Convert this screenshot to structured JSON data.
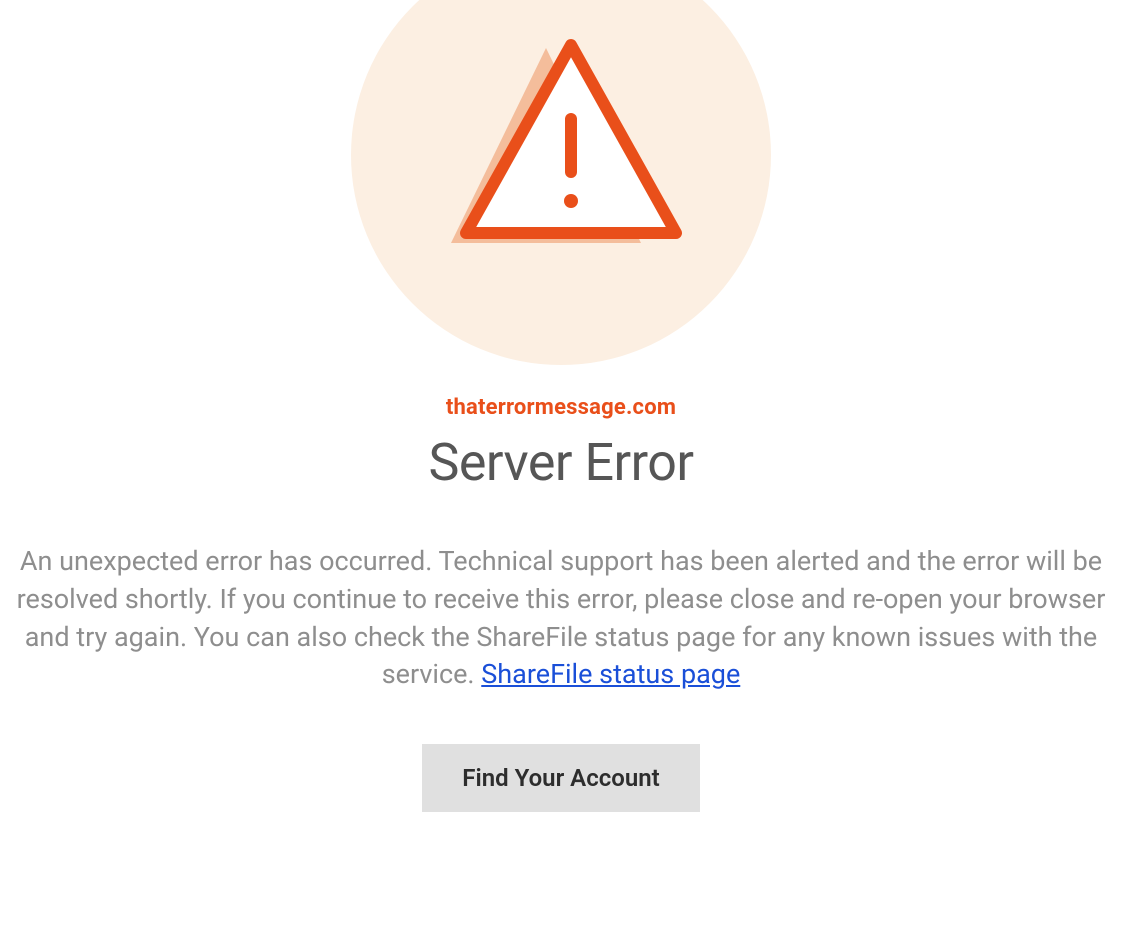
{
  "watermark": "thaterrormessage.com",
  "error_title": "Server Error",
  "error_description": "An unexpected error has occurred. Technical support has been alerted and the error will be resolved shortly. If you continue to receive this error, please close and re-open your browser and try again. You can also check the ShareFile status page for any known issues with the service. ",
  "status_link_text": "ShareFile status page",
  "button_label": "Find Your Account"
}
